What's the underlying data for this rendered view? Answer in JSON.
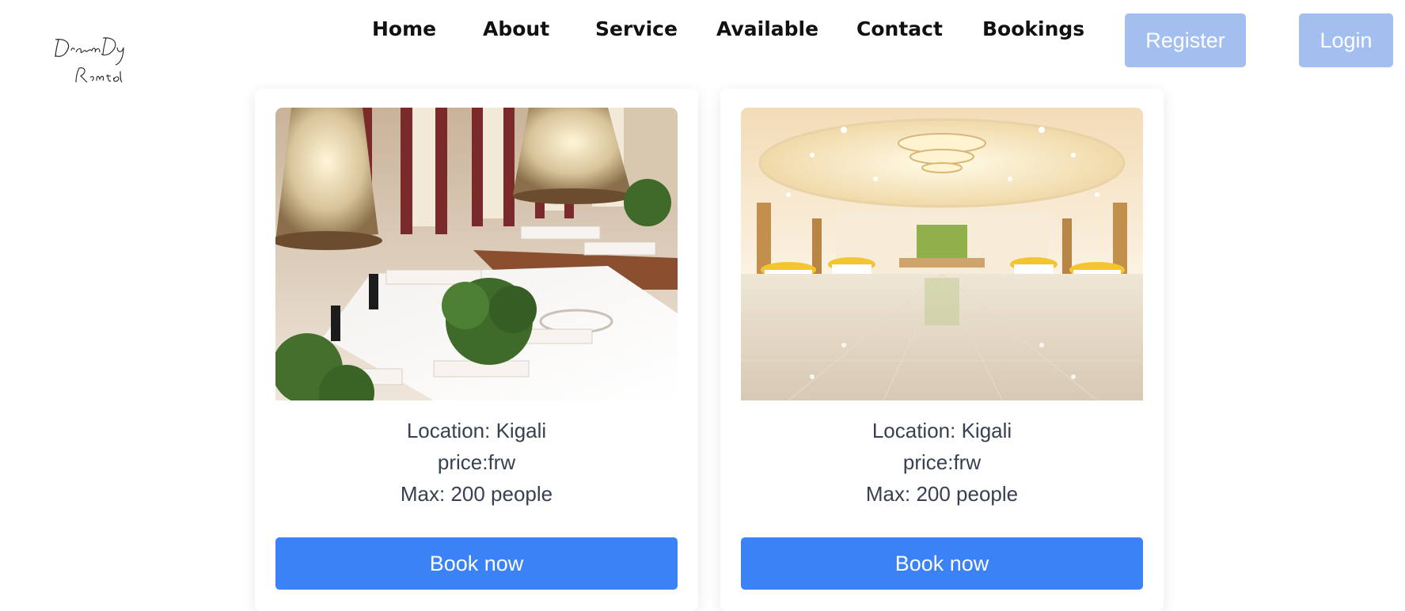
{
  "header": {
    "logo_text": "DreamDay Rental",
    "nav": [
      "Home",
      "About",
      "Service",
      "Available",
      "Contact",
      "Bookings"
    ],
    "register_label": "Register",
    "login_label": "Login",
    "colors": {
      "auth_button": "#a3bfef",
      "nav_text": "#111111"
    }
  },
  "venues": [
    {
      "image": "ballroom-with-chandeliers-image",
      "location": "Location: Kigali",
      "price": "price:frw",
      "capacity": "Max: 200 people",
      "book_label": "Book now"
    },
    {
      "image": "event-hall-with-stage-image",
      "location": "Location: Kigali",
      "price": "price:frw",
      "capacity": "Max: 200 people",
      "book_label": "Book now"
    }
  ],
  "colors": {
    "book_button": "#3b82f6",
    "body_text": "#374151"
  }
}
